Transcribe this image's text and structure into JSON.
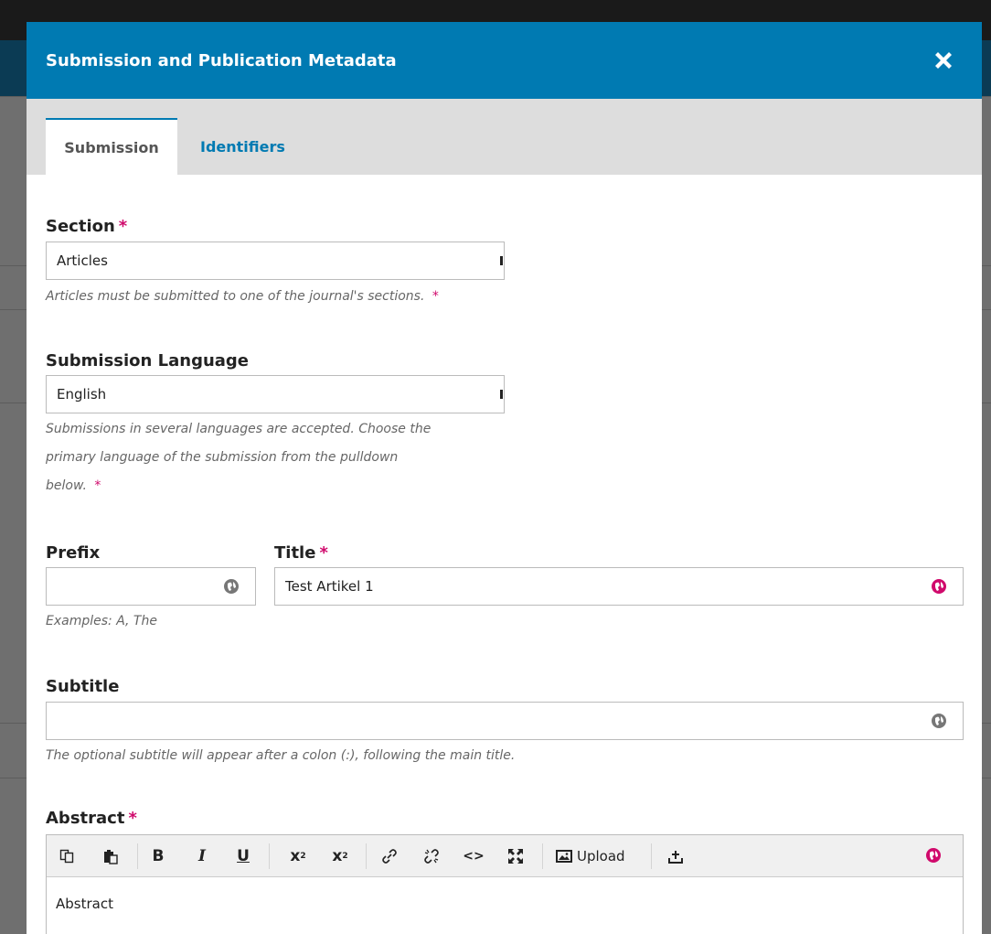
{
  "modal": {
    "title": "Submission and Publication Metadata",
    "close_icon": "close-icon"
  },
  "tabs": [
    {
      "label": "Submission",
      "active": true
    },
    {
      "label": "Identifiers",
      "active": false
    }
  ],
  "section": {
    "label": "Section",
    "required_mark": "*",
    "value": "Articles",
    "help": "Articles must be submitted to one of the journal's sections.",
    "help_required_mark": "*"
  },
  "language": {
    "label": "Submission Language",
    "value": "English",
    "help_line1": "Submissions in several languages are accepted. Choose the",
    "help_line2": "primary language of the submission from the pulldown",
    "help_line3": "below.",
    "help_required_mark": "*"
  },
  "prefix": {
    "label": "Prefix",
    "value": "",
    "help": "Examples: A, The"
  },
  "title": {
    "label": "Title",
    "required_mark": "*",
    "value": "Test Artikel 1"
  },
  "subtitle": {
    "label": "Subtitle",
    "value": "",
    "help": "The optional subtitle will appear after a colon (:), following the main title."
  },
  "abstract": {
    "label": "Abstract",
    "required_mark": "*",
    "toolbar": {
      "upload_label": "Upload"
    },
    "content": "Abstract"
  },
  "colors": {
    "header": "#007ab2",
    "required": "#d00a6c",
    "tab_link": "#007ab2"
  }
}
